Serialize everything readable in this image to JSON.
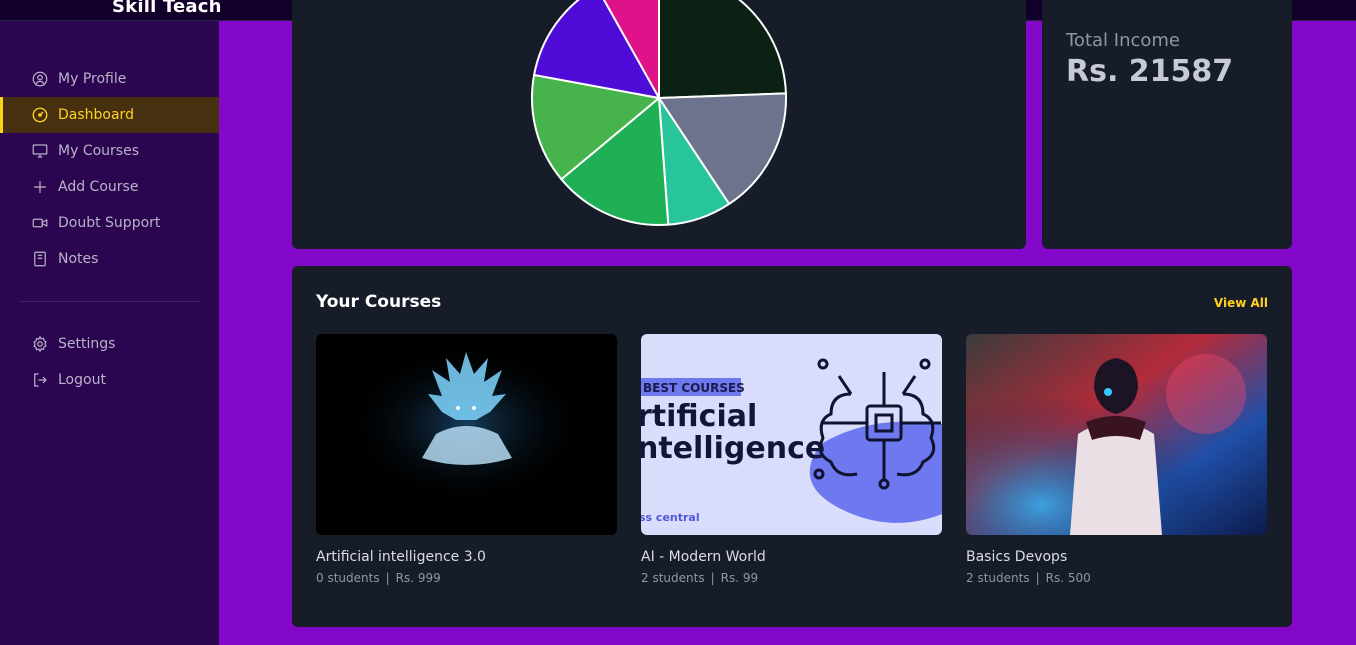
{
  "app": {
    "brand": "Skill Teach"
  },
  "sidebar": {
    "items": [
      {
        "label": "My Profile",
        "icon": "user-circle-icon"
      },
      {
        "label": "Dashboard",
        "icon": "gauge-icon",
        "active": true
      },
      {
        "label": "My Courses",
        "icon": "monitor-icon"
      },
      {
        "label": "Add Course",
        "icon": "plus-icon"
      },
      {
        "label": "Doubt Support",
        "icon": "video-icon"
      },
      {
        "label": "Notes",
        "icon": "notebook-icon"
      }
    ],
    "bottom": [
      {
        "label": "Settings",
        "icon": "gear-icon"
      },
      {
        "label": "Logout",
        "icon": "logout-icon"
      }
    ]
  },
  "income": {
    "label": "Total Income",
    "value": "Rs. 21587"
  },
  "courses": {
    "title": "Your Courses",
    "view_all": "View All",
    "items": [
      {
        "title": "Artificial intelligence 3.0",
        "students": "0 students",
        "price": "Rs. 999"
      },
      {
        "title": "AI - Modern World",
        "students": "2 students",
        "price": "Rs. 99",
        "thumb_text": {
          "badge": "BEST COURSES",
          "line1": "rtificial",
          "line2": "ntelligence",
          "footer": "ss central"
        }
      },
      {
        "title": "Basics Devops",
        "students": "2 students",
        "price": "Rs. 500"
      }
    ]
  },
  "colors": {
    "accent": "#ffd21f",
    "background": "#8408c9",
    "sidebar": "#2b0550",
    "card": "#161d29"
  },
  "pie_slices": [
    {
      "value": 7,
      "color": "#e0128a"
    },
    {
      "value": 21,
      "color": "#0b2114"
    },
    {
      "value": 14,
      "color": "#6e738d"
    },
    {
      "value": 7,
      "color": "#29c59a"
    },
    {
      "value": 13,
      "color": "#1faf55"
    },
    {
      "value": 12,
      "color": "#47b34d"
    },
    {
      "value": 12,
      "color": "#4f0bd8"
    }
  ]
}
